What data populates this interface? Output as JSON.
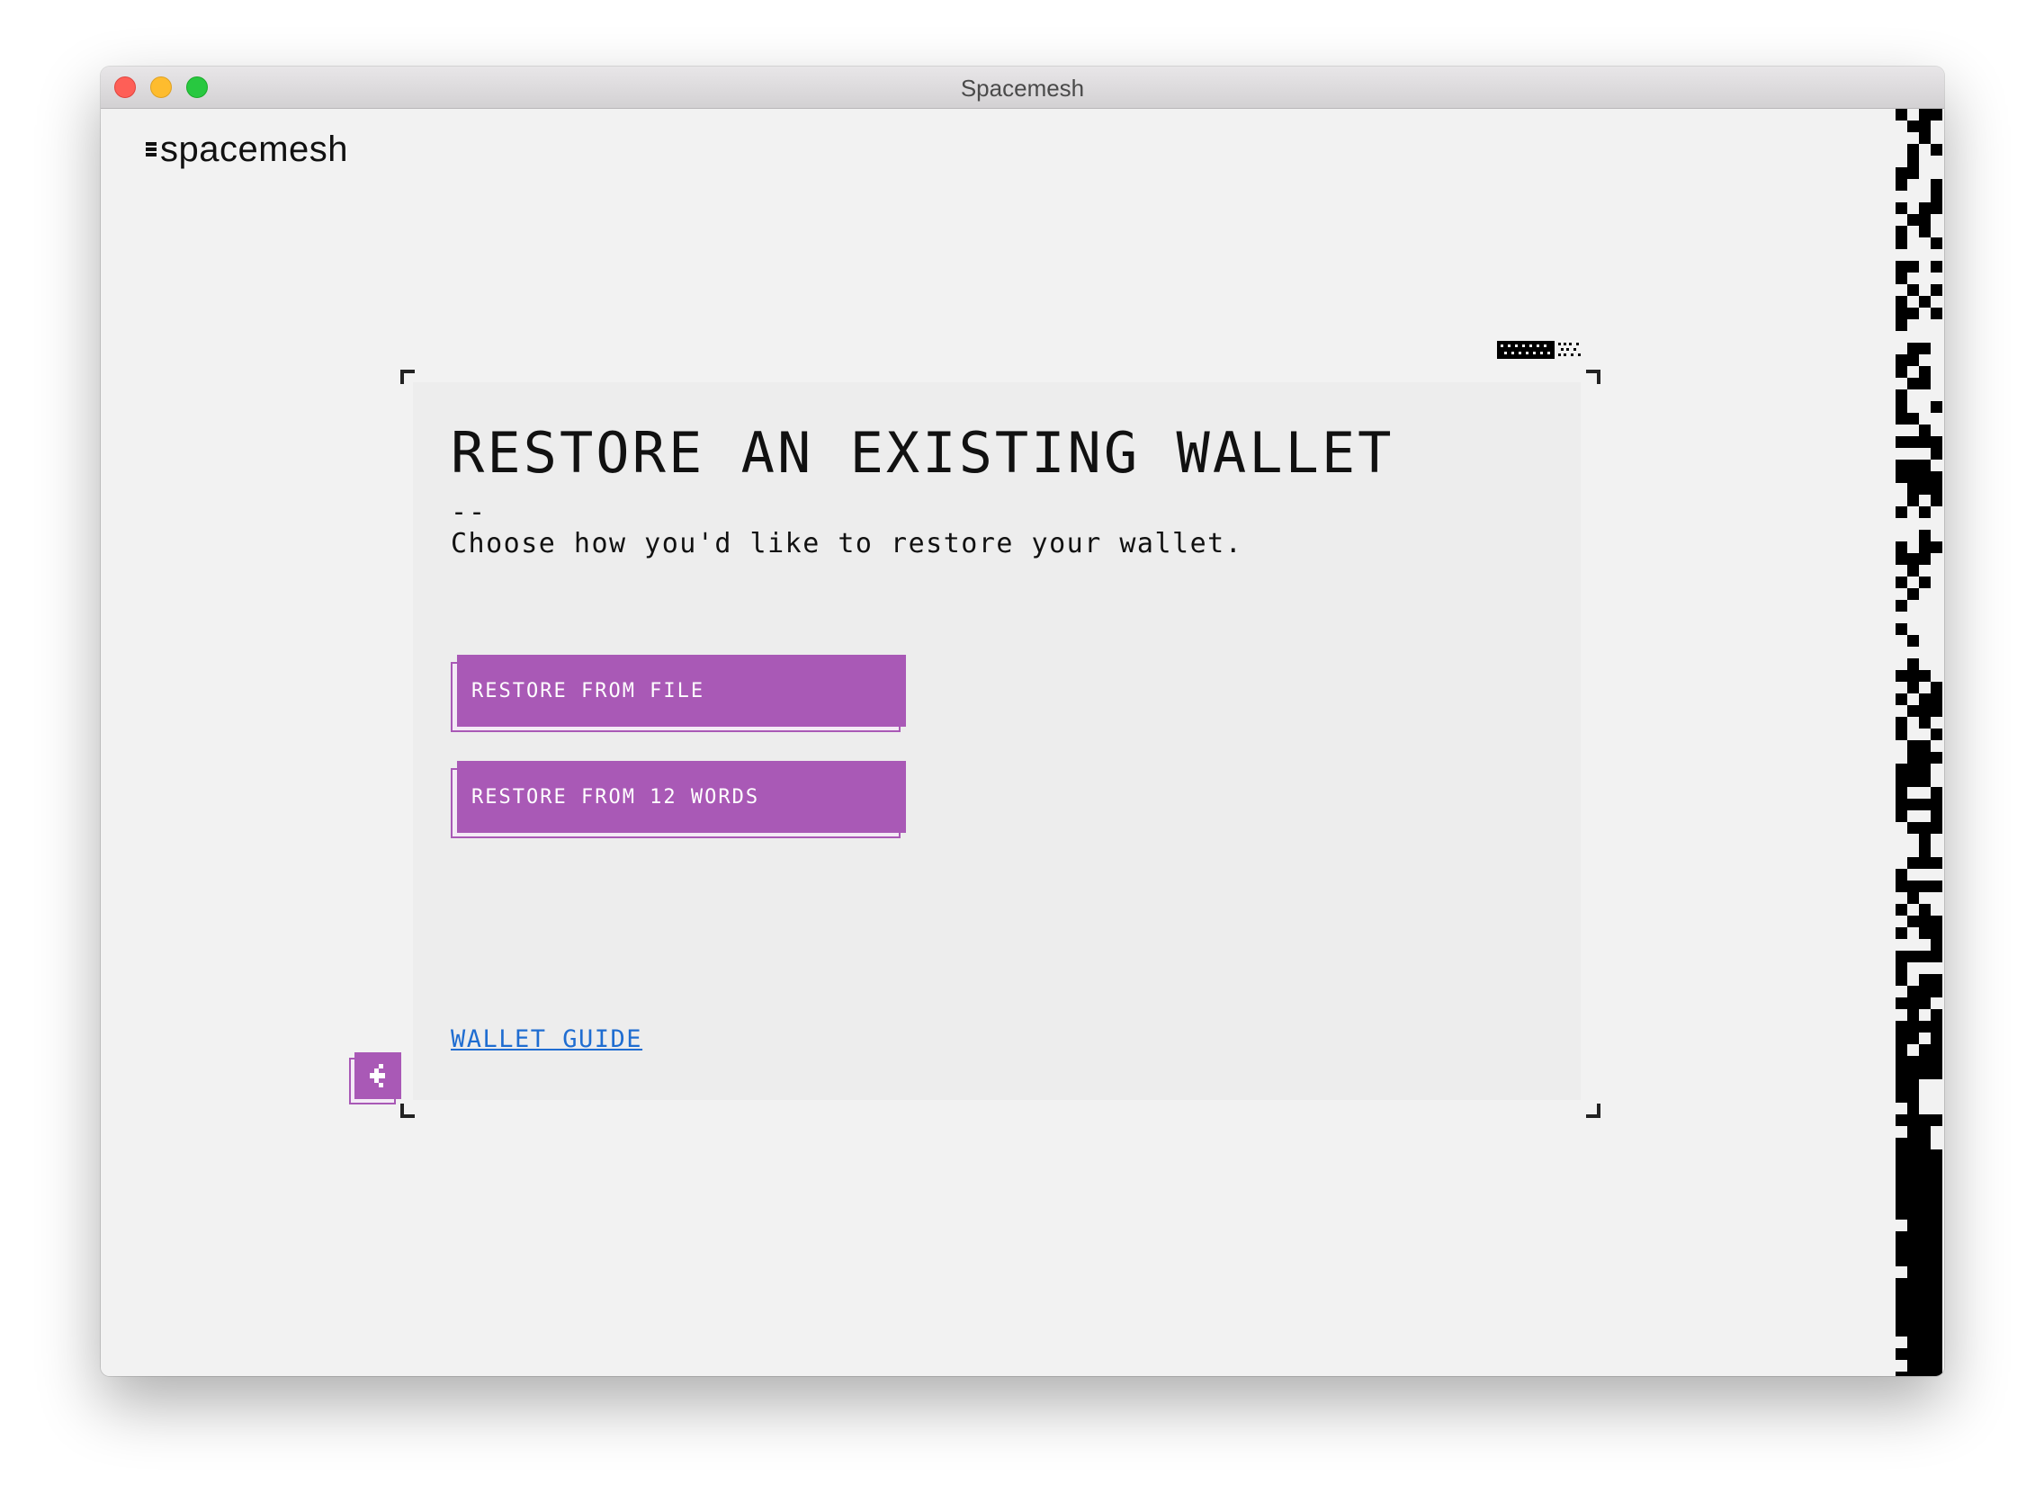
{
  "window": {
    "title": "Spacemesh"
  },
  "logo": {
    "text": "spacemesh"
  },
  "card": {
    "title": "RESTORE AN EXISTING WALLET",
    "divider": "--",
    "subtitle": "Choose how you'd like to restore your wallet.",
    "buttons": [
      {
        "label": "RESTORE FROM FILE"
      },
      {
        "label": "RESTORE FROM 12 WORDS"
      }
    ],
    "guide_link": "WALLET GUIDE"
  },
  "back_button": {
    "icon": "chevron-left-icon"
  },
  "colors": {
    "accent": "#a959b6",
    "link": "#1f6dd1",
    "background": "#f2f2f2",
    "card": "#ededed"
  }
}
